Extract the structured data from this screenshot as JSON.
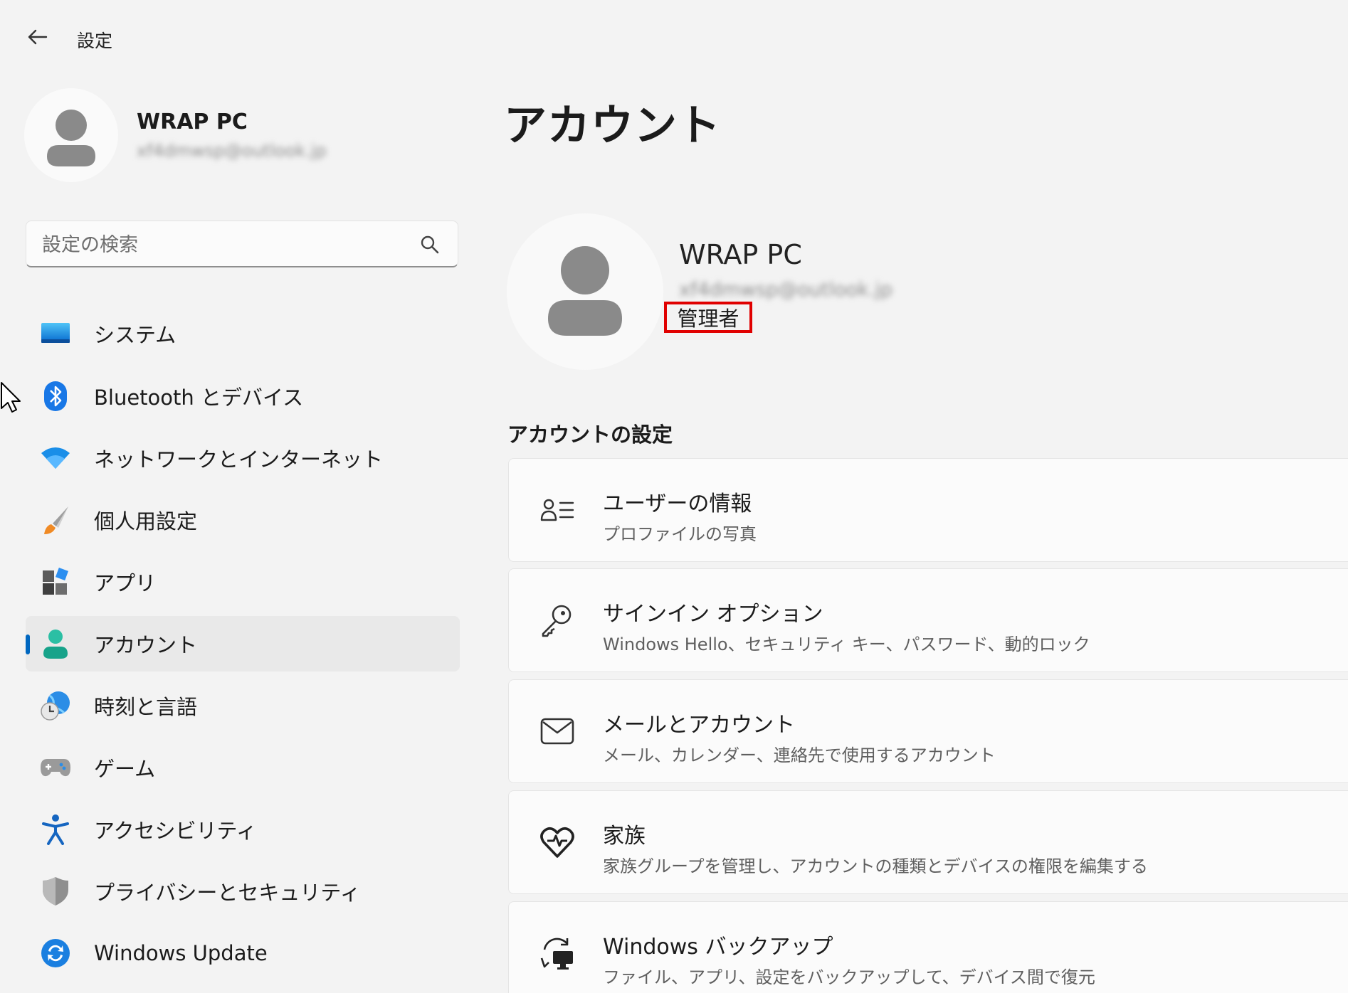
{
  "window": {
    "title": "設定"
  },
  "sidebar": {
    "profile": {
      "name": "WRAP PC",
      "email": "xf4dmwsp@outlook.jp"
    },
    "search": {
      "placeholder": "設定の検索"
    },
    "items": [
      {
        "label": "システム",
        "icon": "system-icon"
      },
      {
        "label": "Bluetooth とデバイス",
        "icon": "bluetooth-icon"
      },
      {
        "label": "ネットワークとインターネット",
        "icon": "wifi-icon"
      },
      {
        "label": "個人用設定",
        "icon": "brush-icon"
      },
      {
        "label": "アプリ",
        "icon": "apps-icon"
      },
      {
        "label": "アカウント",
        "icon": "account-icon",
        "active": true
      },
      {
        "label": "時刻と言語",
        "icon": "time-language-icon"
      },
      {
        "label": "ゲーム",
        "icon": "gamepad-icon"
      },
      {
        "label": "アクセシビリティ",
        "icon": "accessibility-icon"
      },
      {
        "label": "プライバシーとセキュリティ",
        "icon": "shield-icon"
      },
      {
        "label": "Windows Update",
        "icon": "windows-update-icon"
      }
    ]
  },
  "main": {
    "title": "アカウント",
    "account": {
      "name": "WRAP PC",
      "email": "xf4dmwsp@outlook.jp",
      "role": "管理者"
    },
    "section_heading": "アカウントの設定",
    "cards": [
      {
        "title": "ユーザーの情報",
        "subtitle": "プロファイルの写真",
        "icon": "user-info-icon"
      },
      {
        "title": "サインイン オプション",
        "subtitle": "Windows Hello、セキュリティ キー、パスワード、動的ロック",
        "icon": "key-icon"
      },
      {
        "title": "メールとアカウント",
        "subtitle": "メール、カレンダー、連絡先で使用するアカウント",
        "icon": "mail-icon"
      },
      {
        "title": "家族",
        "subtitle": "家族グループを管理し、アカウントの種類とデバイスの権限を編集する",
        "icon": "family-heart-icon"
      },
      {
        "title": "Windows バックアップ",
        "subtitle": "ファイル、アプリ、設定をバックアップして、デバイス間で復元",
        "icon": "backup-icon"
      }
    ]
  },
  "colors": {
    "accent": "#0067c0",
    "highlight_border": "#e00000",
    "background": "#f3f3f3"
  }
}
